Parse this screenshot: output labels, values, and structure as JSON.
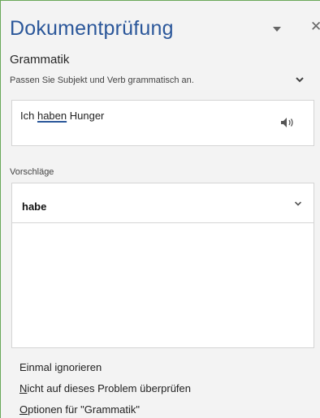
{
  "pane": {
    "title": "Dokumentprüfung",
    "menu_icon": "dropdown-triangle-icon",
    "close_icon": "close-icon",
    "accent_color": "#2b579a"
  },
  "issue": {
    "category": "Grammatik",
    "explanation": "Passen Sie Subjekt und Verb grammatisch an.",
    "expand_icon": "chevron-down-icon"
  },
  "context": {
    "before": "Ich ",
    "error_word": "haben",
    "after": " Hunger",
    "speaker_icon": "speaker-icon"
  },
  "suggestions": {
    "heading": "Vorschläge",
    "items": [
      {
        "text": "habe",
        "expand_icon": "chevron-down-icon"
      }
    ]
  },
  "actions": {
    "ignore_once": {
      "pre": "Einmal i",
      "access_key": "g",
      "post": "norieren"
    },
    "dont_check": {
      "pre": "",
      "access_key": "N",
      "post": "icht auf dieses Problem überprüfen"
    },
    "options": {
      "pre": "",
      "access_key": "O",
      "post": "ptionen für \"Grammatik\""
    }
  }
}
